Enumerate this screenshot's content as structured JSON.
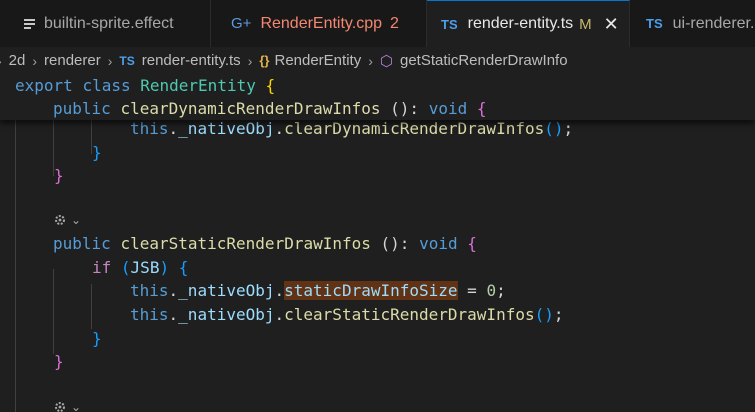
{
  "tabs": [
    {
      "label": "builtin-sprite.effect",
      "icon": "lines-icon"
    },
    {
      "label": "RenderEntity.cpp",
      "icon": "cpp-icon",
      "badge": "2"
    },
    {
      "label": "render-entity.ts",
      "icon": "ts-icon",
      "modified": "M",
      "active": true
    },
    {
      "label": "ui-renderer.",
      "icon": "ts-icon"
    }
  ],
  "breadcrumb": {
    "lead": "2d",
    "items": [
      "renderer",
      "render-entity.ts",
      "RenderEntity",
      "getStaticRenderDrawInfo"
    ],
    "ts_badge": "TS"
  },
  "colors": {
    "accent": "#0078d4",
    "highlight": "#613214"
  },
  "code": {
    "sticky": [
      {
        "export": "export",
        "class": "class",
        "name": "RenderEntity",
        "open": "{"
      },
      {
        "public": "public",
        "name": "clearDynamicRenderDrawInfos",
        "sig": " (): ",
        "type": "void",
        "open": "{"
      }
    ],
    "line_dyn_call": {
      "this": "this",
      "dot1": ".",
      "obj": "_nativeObj",
      "dot2": ".",
      "fn": "clearDynamicRenderDrawInfos",
      "paren": "()",
      "semi": ";"
    },
    "close_inner": "}",
    "close_method": "}",
    "method2": {
      "public": "public",
      "name": "clearStaticRenderDrawInfos",
      "sig": " (): ",
      "type": "void",
      "open": "{"
    },
    "if_line": {
      "kw": "if",
      "open": "(",
      "var": "JSB",
      "close": ")",
      "brace": "{"
    },
    "assign_line": {
      "this": "this",
      "dot1": ".",
      "obj": "_nativeObj",
      "dot2": ".",
      "prop": "staticDrawInfoSize",
      "op": " = ",
      "num": "0",
      "semi": ";"
    },
    "call_line": {
      "this": "this",
      "dot1": ".",
      "obj": "_nativeObj",
      "dot2": ".",
      "fn": "clearStaticRenderDrawInfos",
      "paren": "()",
      "semi": ";"
    },
    "close_if": "}",
    "close_method2": "}"
  }
}
